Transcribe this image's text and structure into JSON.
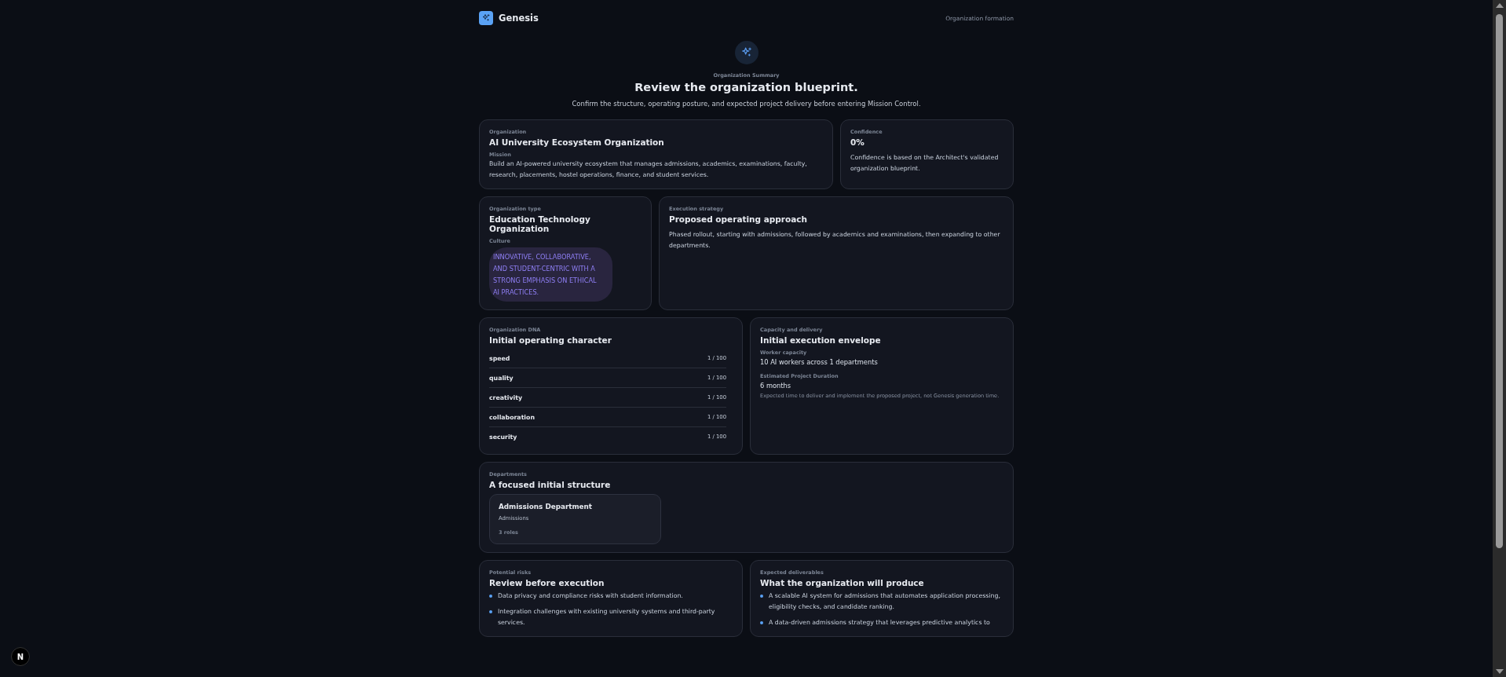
{
  "header": {
    "brand": "Genesis",
    "context": "Organization formation"
  },
  "hero": {
    "eyebrow": "Organization Summary",
    "title": "Review the organization blueprint.",
    "subtitle": "Confirm the structure, operating posture, and expected project delivery before entering Mission Control."
  },
  "organization": {
    "label": "Organization",
    "name": "AI University Ecosystem Organization",
    "mission_label": "Mission",
    "mission": "Build an AI-powered university ecosystem that manages admissions, academics, examinations, faculty, research, placements, hostel operations, finance, and student services."
  },
  "confidence": {
    "label": "Confidence",
    "value": "0%",
    "note": "Confidence is based on the Architect's validated organization blueprint."
  },
  "org_type": {
    "label": "Organization type",
    "name": "Education Technology Organization",
    "culture_label": "Culture",
    "culture": "INNOVATIVE, COLLABORATIVE, AND STUDENT-CENTRIC WITH A STRONG EMPHASIS ON ETHICAL AI PRACTICES."
  },
  "strategy": {
    "label": "Execution strategy",
    "title": "Proposed operating approach",
    "text": "Phased rollout, starting with admissions, followed by academics and examinations, then expanding to other departments."
  },
  "dna": {
    "label": "Organization DNA",
    "title": "Initial operating character",
    "traits": [
      {
        "name": "speed",
        "score": "1 / 100"
      },
      {
        "name": "quality",
        "score": "1 / 100"
      },
      {
        "name": "creativity",
        "score": "1 / 100"
      },
      {
        "name": "collaboration",
        "score": "1 / 100"
      },
      {
        "name": "security",
        "score": "1 / 100"
      }
    ]
  },
  "capacity": {
    "label": "Capacity and delivery",
    "title": "Initial execution envelope",
    "worker_label": "Worker capacity",
    "workers": "10 AI workers across 1 departments",
    "duration_label": "Estimated Project Duration",
    "duration": "6 months",
    "duration_note": "Expected time to deliver and implement the proposed project, not Genesis generation time."
  },
  "departments": {
    "label": "Departments",
    "title": "A focused initial structure",
    "items": [
      {
        "name": "Admissions Department",
        "focus": "Admissions",
        "roles": "3 roles"
      }
    ]
  },
  "risks": {
    "label": "Potential risks",
    "title": "Review before execution",
    "items": [
      "Data privacy and compliance risks with student information.",
      "Integration challenges with existing university systems and third-party services."
    ]
  },
  "deliverables": {
    "label": "Expected deliverables",
    "title": "What the organization will produce",
    "items": [
      "A scalable AI system for admissions that automates application processing, eligibility checks, and candidate ranking.",
      "A data-driven admissions strategy that leverages predictive analytics to"
    ]
  },
  "dev_badge": "N"
}
